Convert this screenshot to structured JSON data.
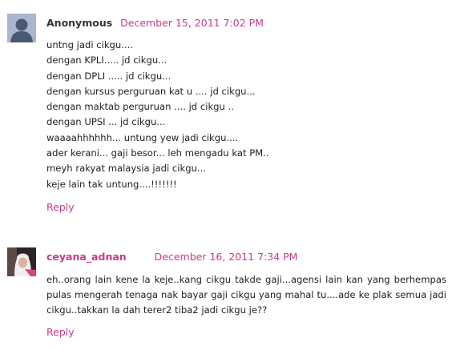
{
  "comments": [
    {
      "author": "Anonymous",
      "date": "December 15, 2011 7:02 PM",
      "avatar_icon": "default-avatar-silhouette-icon",
      "lines": [
        "untng jadi cikgu....",
        "dengan KPLI..... jd cikgu...",
        "dengan DPLI ..... jd cikgu...",
        "dengan kursus perguruan kat u .... jd cikgu...",
        "dengan maktab perguruan .... jd cikgu ..",
        "dengan UPSI ... jd cikgu...",
        "waaaahhhhhh... untung yew jadi cikgu....",
        "ader kerani... gaji besor... leh mengadu kat PM..",
        "meyh rakyat malaysia jadi cikgu...",
        "keje lain tak untung....!!!!!!!"
      ],
      "reply_label": "Reply"
    },
    {
      "author": "ceyana_adnan",
      "date": "December 16, 2011 7:34 PM",
      "avatar_icon": "user-photo-avatar",
      "text": "eh..orang lain kene la keje..kang cikgu takde gaji...agensi lain kan yang berhempas pulas mengerah tenaga nak bayar gaji cikgu yang mahal tu....ade ke plak semua jadi cikgu..takkan la dah terer2 tiba2 jadi cikgu je??",
      "reply_label": "Reply"
    }
  ],
  "colors": {
    "link": "#cc3a8a",
    "text": "#222222"
  }
}
